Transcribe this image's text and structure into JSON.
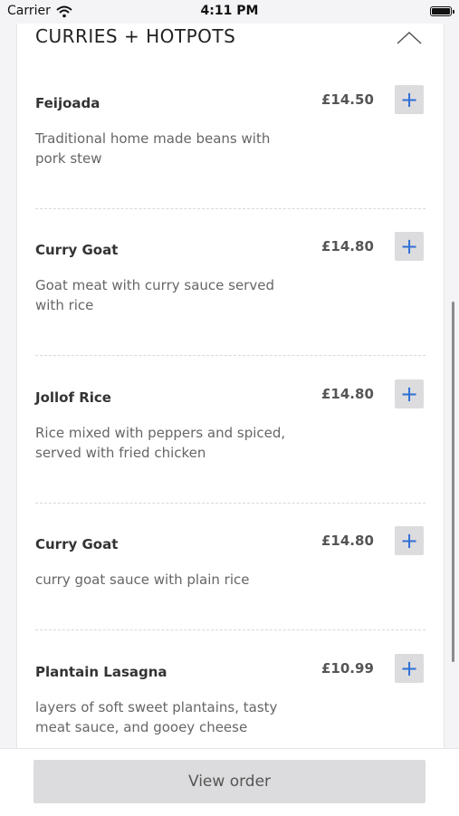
{
  "status_bar": {
    "carrier": "Carrier",
    "time": "4:11 PM"
  },
  "section": {
    "title": "CURRIES + HOTPOTS"
  },
  "items": [
    {
      "name": "Feijoada",
      "price": "£14.50",
      "description": "Traditional home made beans with pork stew",
      "add_label": "+"
    },
    {
      "name": "Curry Goat",
      "price": "£14.80",
      "description": "Goat meat with curry sauce served with rice",
      "add_label": "+"
    },
    {
      "name": "Jollof Rice",
      "price": "£14.80",
      "description": "Rice mixed with peppers and spiced, served with fried chicken",
      "add_label": "+"
    },
    {
      "name": "Curry Goat",
      "price": "£14.80",
      "description": "curry goat sauce with plain rice",
      "add_label": "+"
    },
    {
      "name": "Plantain Lasagna",
      "price": "£10.99",
      "description": "layers of soft sweet plantains, tasty meat sauce, and gooey cheese",
      "add_label": "+"
    }
  ],
  "footer": {
    "view_order_label": "View order"
  },
  "colors": {
    "accent": "#2f6fd6",
    "button_bg": "#dcdcde"
  }
}
